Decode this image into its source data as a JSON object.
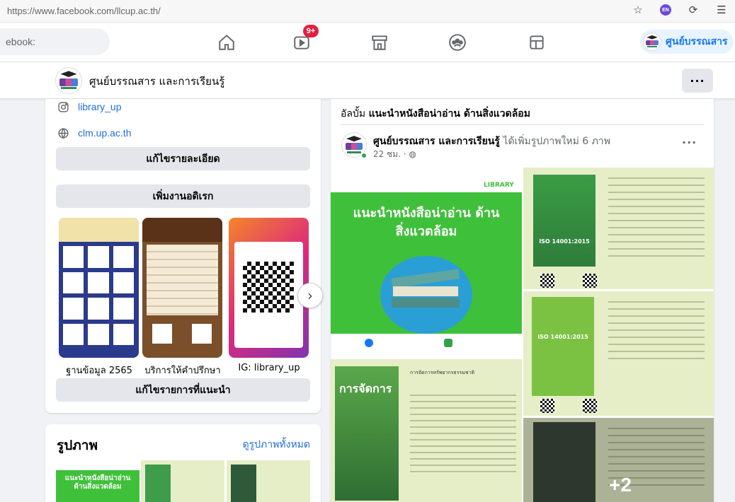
{
  "browser": {
    "url": "https://www.facebook.com/llcup.ac.th/",
    "ext_badge": "EN"
  },
  "nav": {
    "search_placeholder": "ebook:",
    "watch_badge": "9+",
    "profile_name": "ศูนย์บรรณสาร"
  },
  "page": {
    "name": "ศูนย์บรรณสาร และการเรียนรู้",
    "more": "···"
  },
  "intro": {
    "instagram": "library_up",
    "website": "clm.up.ac.th",
    "edit_details_button": "แก้ไขรายละเอียด",
    "add_featured_button": "เพิ่มงานอดิเรก",
    "edit_featured_button": "แก้ไขรายการที่แนะนำ"
  },
  "featured": [
    {
      "label": "ฐานข้อมูล 2565"
    },
    {
      "label": "บริการให้คำปรึกษา"
    },
    {
      "label": "IG: library_up"
    }
  ],
  "photos": {
    "title": "รูปภาพ",
    "see_all": "ดูรูปภาพทั้งหมด",
    "thumb1_text": "แนะนำหนังสือน่าอ่าน ด้านสิ่งแวดล้อม"
  },
  "post": {
    "album_prefix": "อัลบั้ม ",
    "album_name": "แนะนำหนังสือน่าอ่าน ด้านสิ่งแวดล้อม",
    "author": "ศูนย์บรรณสาร และการเรียนรู้",
    "action": " ได้เพิ่มรูปภาพใหม่ 6 ภาพ",
    "time": "22 ชม. · ",
    "more": "···",
    "main_image_title": "แนะนำหนังสือน่าอ่าน ด้านสิ่งแวดล้อม",
    "main_image_logo": "LIBRARY",
    "book1_cover": "ISO 14001:2015",
    "book2_cover": "ISO 14001:2015",
    "book3_cover": "การจัดการ",
    "book3_title": "การจัดการทรัพยากรธรรมชาติ",
    "more_count": "+2"
  },
  "colors": {
    "fb_blue": "#1877f2",
    "green_banner": "#3fc03a",
    "badge_red": "#e41e3f"
  }
}
